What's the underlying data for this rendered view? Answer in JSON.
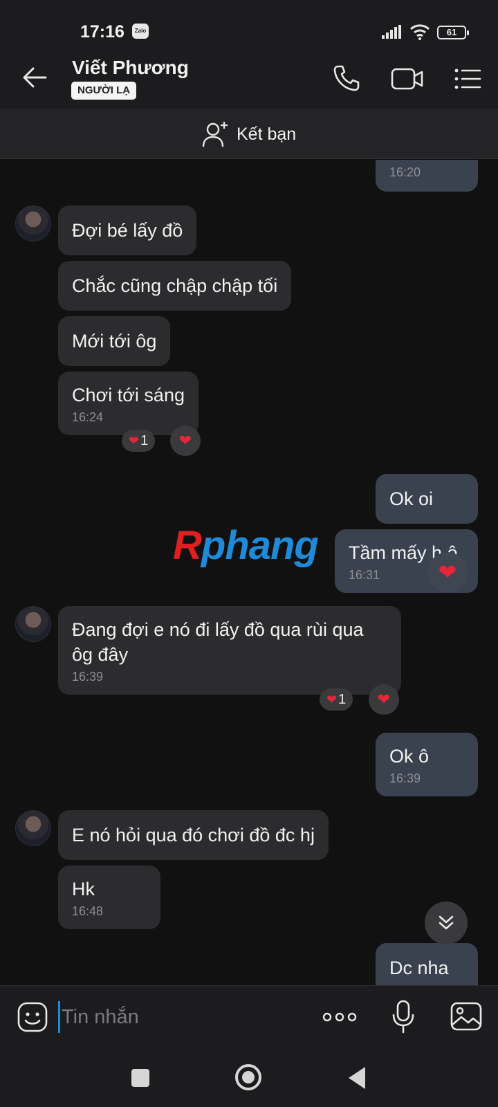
{
  "status_bar": {
    "time": "17:16",
    "app_badge": "Zalo",
    "battery": "61"
  },
  "header": {
    "contact_name": "Viết Phương",
    "badge": "NGƯỜI LẠ"
  },
  "add_friend": {
    "label": "Kết bạn"
  },
  "messages": {
    "m0": {
      "time": "16:20"
    },
    "m1": {
      "text": "Đợi bé lấy đồ"
    },
    "m2": {
      "text": "Chắc cũng chập chập tối"
    },
    "m3": {
      "text": "Mới tới ôg"
    },
    "m4": {
      "text": "Chơi tới sáng",
      "time": "16:24",
      "reaction_count": "1"
    },
    "m5": {
      "text": "Ok oi"
    },
    "m6": {
      "text": "Tầm mấy h ô",
      "time": "16:31"
    },
    "m7": {
      "text": "Đang đợi e nó đi lấy đồ qua rùi qua\nôg đây",
      "time": "16:39",
      "reaction_count": "1"
    },
    "m8": {
      "text": "Ok ô",
      "time": "16:39"
    },
    "m9": {
      "text": "E nó hỏi qua đó chơi đồ đc hj"
    },
    "m10": {
      "text": "Hk",
      "time": "16:48"
    },
    "m11": {
      "text": "Dc nha"
    }
  },
  "watermark": {
    "part1": "R",
    "part2": "phang"
  },
  "composer": {
    "placeholder": "Tin nhắn"
  },
  "colors": {
    "accent": "#1e8ad8",
    "heart": "#e3263a",
    "incoming_bubble": "#2c2c2e",
    "outgoing_bubble": "#3a4250"
  },
  "icons": [
    "back-arrow-icon",
    "phone-icon",
    "video-icon",
    "list-menu-icon",
    "add-person-icon",
    "heart-icon",
    "chevron-double-down-icon",
    "sticker-icon",
    "more-icon",
    "mic-icon",
    "gallery-icon"
  ]
}
